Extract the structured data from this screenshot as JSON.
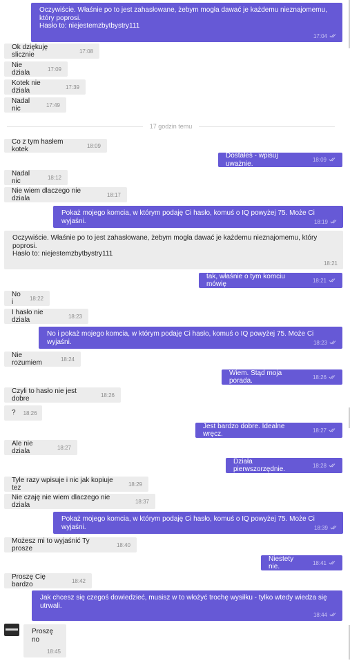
{
  "divider_label": "17 godzin temu",
  "colors": {
    "outgoing_bubble": "#6659d6",
    "incoming_bubble": "#ececec",
    "page_background": "#ffffff"
  },
  "icons": {
    "read_receipt": "double-check-icon"
  },
  "messages": [
    {
      "dir": "out",
      "text": "Oczywiście. Właśnie po to jest zahasłowane, żebym mogła dawać je każdemu nieznajomemu,\nktóry poprosi.\nHasło to: niejestemzbytbystry111",
      "time": "17:04",
      "read": true
    },
    {
      "dir": "in",
      "text": "Ok dziękuję slicznie",
      "time": "17:08"
    },
    {
      "dir": "in",
      "text": "Nie dziala",
      "time": "17:09"
    },
    {
      "dir": "in",
      "text": "Kotek nie dziala",
      "time": "17:39"
    },
    {
      "dir": "in",
      "text": "Nadal nic",
      "time": "17:49"
    },
    {
      "dir": "in",
      "text": "Co z tym hasłem kotek",
      "time": "18:09"
    },
    {
      "dir": "out",
      "text": "Dostałeś - wpisuj uważnie.",
      "time": "18:09",
      "read": true
    },
    {
      "dir": "in",
      "text": "Nadal nic",
      "time": "18:12"
    },
    {
      "dir": "in",
      "text": "Nie wiem dlaczego nie dziala",
      "time": "18:17"
    },
    {
      "dir": "out",
      "text": "Pokaż mojego komcia, w którym podaję Ci hasło, komuś o IQ powyżej 75. Może Ci wyjaśni.",
      "time": "18:19",
      "read": true
    },
    {
      "dir": "in",
      "text": "Oczywiście. Właśnie po to jest zahasłowane, żebym mogła dawać je każdemu nieznajomemu, który\npoprosi.\nHasło to: niejestemzbytbystry111",
      "time": "18:21"
    },
    {
      "dir": "out",
      "text": "tak, właśnie o tym komciu mówię",
      "time": "18:21",
      "read": true
    },
    {
      "dir": "in",
      "text": "No i",
      "time": "18:22"
    },
    {
      "dir": "in",
      "text": "I hasło nie dziala",
      "time": "18:23"
    },
    {
      "dir": "out",
      "text": "No i pokaż mojego komcia, w którym podaję Ci hasło, komuś o IQ powyżej 75. Może Ci wyjaśni.",
      "time": "18:23",
      "read": true
    },
    {
      "dir": "in",
      "text": "Nie rozumiem",
      "time": "18:24"
    },
    {
      "dir": "out",
      "text": "Wiem. Stąd moja porada.",
      "time": "18:26",
      "read": true
    },
    {
      "dir": "in",
      "text": "Czyli to hasło nie jest dobre",
      "time": "18:26"
    },
    {
      "dir": "in",
      "text": "?",
      "time": "18:26"
    },
    {
      "dir": "out",
      "text": "Jest bardzo dobre. Idealne wręcz.",
      "time": "18:27",
      "read": true
    },
    {
      "dir": "in",
      "text": "Ale nie dziala",
      "time": "18:27"
    },
    {
      "dir": "out",
      "text": "Działa pierwszorzędnie.",
      "time": "18:28",
      "read": true
    },
    {
      "dir": "in",
      "text": "Tyle razy wpisuje i nic jak kopiuje tez",
      "time": "18:29"
    },
    {
      "dir": "in",
      "text": "Nie czaję nie wiem dlaczego nie dziala",
      "time": "18:37"
    },
    {
      "dir": "out",
      "text": "Pokaż mojego komcia, w którym podaję Ci hasło, komuś o IQ powyżej 75. Może Ci wyjaśni.",
      "time": "18:39",
      "read": true
    },
    {
      "dir": "in",
      "text": "Możesz mi to wyjaśnić Ty prosze",
      "time": "18:40"
    },
    {
      "dir": "out",
      "text": "Niestety nie.",
      "time": "18:41",
      "read": true
    },
    {
      "dir": "in",
      "text": "Proszę Cię bardzo",
      "time": "18:42"
    },
    {
      "dir": "out",
      "text": "Jak chcesz się czegoś dowiedzieć, musisz w to włożyć trochę wysiłku - tylko wtedy wiedza się\nutrwali.",
      "time": "18:44",
      "read": true
    },
    {
      "dir": "in",
      "text": "Proszę no",
      "time": "18:45"
    }
  ]
}
